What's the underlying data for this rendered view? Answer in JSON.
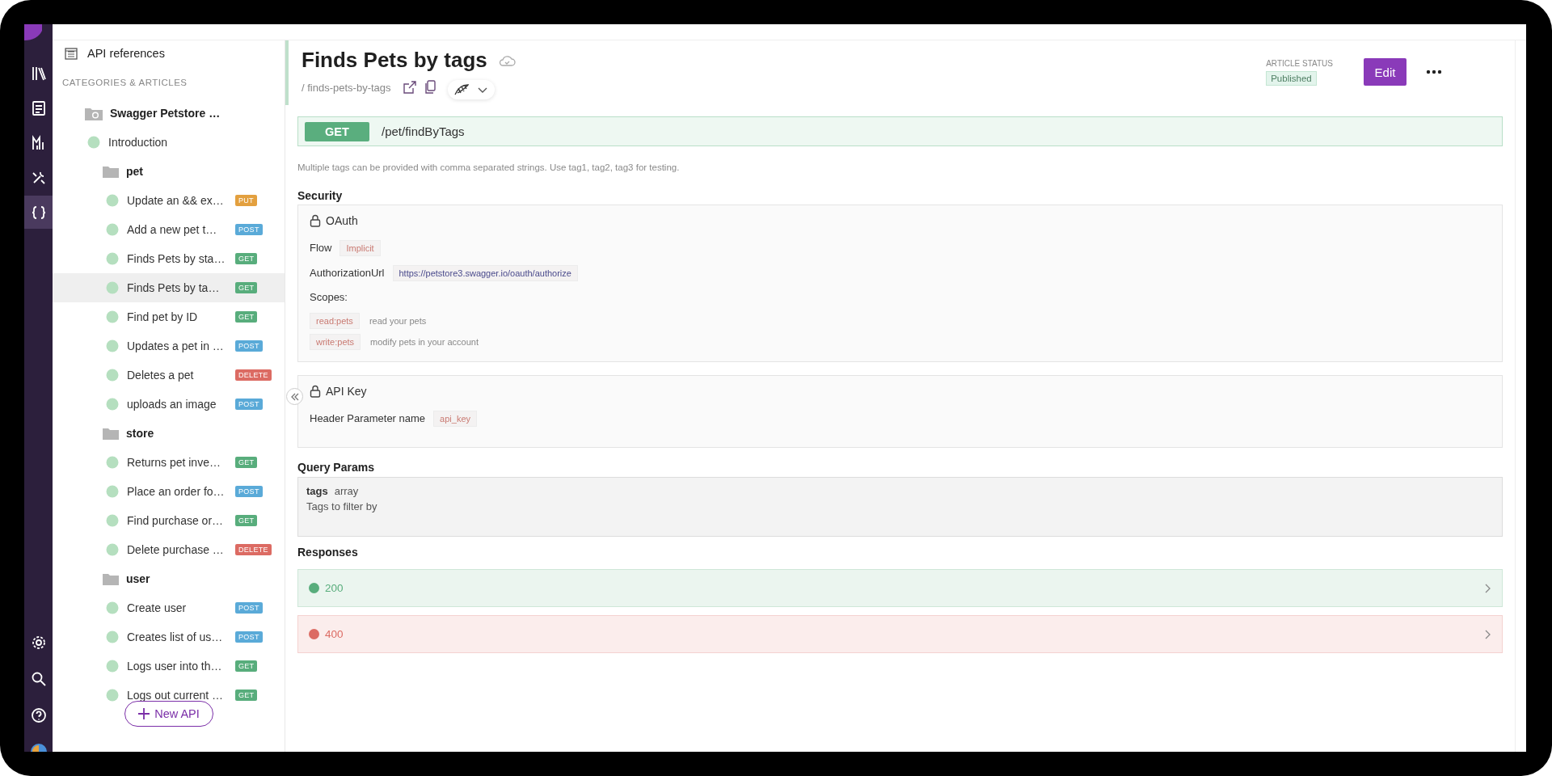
{
  "rail": {
    "items": [
      {
        "selected": false
      },
      {
        "selected": false
      },
      {
        "selected": false
      },
      {
        "selected": false
      },
      {
        "selected": true
      }
    ]
  },
  "sidebar": {
    "header": "API references",
    "section_label": "CATEGORIES & ARTICLES",
    "tree": [
      {
        "kind": "root",
        "label": "Swagger Petstore …",
        "selected": false,
        "children": [
          {
            "kind": "article",
            "label": "Introduction",
            "selected": false
          },
          {
            "kind": "folder",
            "label": "pet",
            "selected": false,
            "children": [
              {
                "kind": "article",
                "label": "Update an && ex…",
                "method": "PUT",
                "color": "#e3a03f",
                "selected": false
              },
              {
                "kind": "article",
                "label": "Add a new pet t…",
                "method": "POST",
                "color": "#5aaad8",
                "selected": false
              },
              {
                "kind": "article",
                "label": "Finds Pets by sta…",
                "method": "GET",
                "color": "#58ad7c",
                "selected": false
              },
              {
                "kind": "article",
                "label": "Finds Pets by ta…",
                "method": "GET",
                "color": "#58ad7c",
                "selected": true
              },
              {
                "kind": "article",
                "label": "Find pet by ID",
                "method": "GET",
                "color": "#58ad7c",
                "selected": false
              },
              {
                "kind": "article",
                "label": "Updates a pet in …",
                "method": "POST",
                "color": "#5aaad8",
                "selected": false
              },
              {
                "kind": "article",
                "label": "Deletes a pet",
                "method": "DELETE",
                "color": "#dc6b63",
                "selected": false
              },
              {
                "kind": "article",
                "label": "uploads an image",
                "method": "POST",
                "color": "#5aaad8",
                "selected": false
              }
            ]
          },
          {
            "kind": "folder",
            "label": "store",
            "selected": false,
            "children": [
              {
                "kind": "article",
                "label": "Returns pet inve…",
                "method": "GET",
                "color": "#58ad7c",
                "selected": false
              },
              {
                "kind": "article",
                "label": "Place an order fo…",
                "method": "POST",
                "color": "#5aaad8",
                "selected": false
              },
              {
                "kind": "article",
                "label": "Find purchase or…",
                "method": "GET",
                "color": "#58ad7c",
                "selected": false
              },
              {
                "kind": "article",
                "label": "Delete purchase …",
                "method": "DELETE",
                "color": "#dc6b63",
                "selected": false
              }
            ]
          },
          {
            "kind": "folder",
            "label": "user",
            "selected": false,
            "children": [
              {
                "kind": "article",
                "label": "Create user",
                "method": "POST",
                "color": "#5aaad8",
                "selected": false
              },
              {
                "kind": "article",
                "label": "Creates list of us…",
                "method": "POST",
                "color": "#5aaad8",
                "selected": false
              },
              {
                "kind": "article",
                "label": "Logs user into th…",
                "method": "GET",
                "color": "#58ad7c",
                "selected": false
              },
              {
                "kind": "article",
                "label": "Logs out current …",
                "method": "GET",
                "color": "#58ad7c",
                "selected": false
              }
            ]
          }
        ]
      }
    ],
    "new_button": "New API"
  },
  "article": {
    "title": "Finds Pets by tags",
    "slug": "/ finds-pets-by-tags",
    "status_label": "ARTICLE STATUS",
    "status": "Published",
    "edit_button": "Edit",
    "method": "GET",
    "path": "/pet/findByTags",
    "description": "Multiple tags can be provided with comma separated strings. Use tag1, tag2, tag3 for testing.",
    "security": {
      "heading": "Security",
      "schemes": [
        {
          "kind": "oauth",
          "name": "OAuth",
          "fields": [
            {
              "label": "Flow",
              "value": "Implicit",
              "kind": "tag"
            },
            {
              "label": "AuthorizationUrl",
              "value": "https://petstore3.swagger.io/oauth/authorize",
              "kind": "url"
            }
          ],
          "scopes_label": "Scopes:",
          "scopes": [
            {
              "name": "read:pets",
              "description": "read your pets"
            },
            {
              "name": "write:pets",
              "description": "modify pets in your account"
            }
          ]
        },
        {
          "kind": "apikey",
          "name": "API Key",
          "fields": [
            {
              "label": "Header Parameter name",
              "value": "api_key",
              "kind": "tag"
            }
          ]
        }
      ]
    },
    "query_params": {
      "heading": "Query Params",
      "params": [
        {
          "name": "tags",
          "type": "array",
          "description": "Tags to filter by"
        }
      ]
    },
    "responses": {
      "heading": "Responses",
      "items": [
        {
          "code": "200",
          "color": "#58ad7c"
        },
        {
          "code": "400",
          "color": "#dc6b63"
        }
      ]
    }
  }
}
